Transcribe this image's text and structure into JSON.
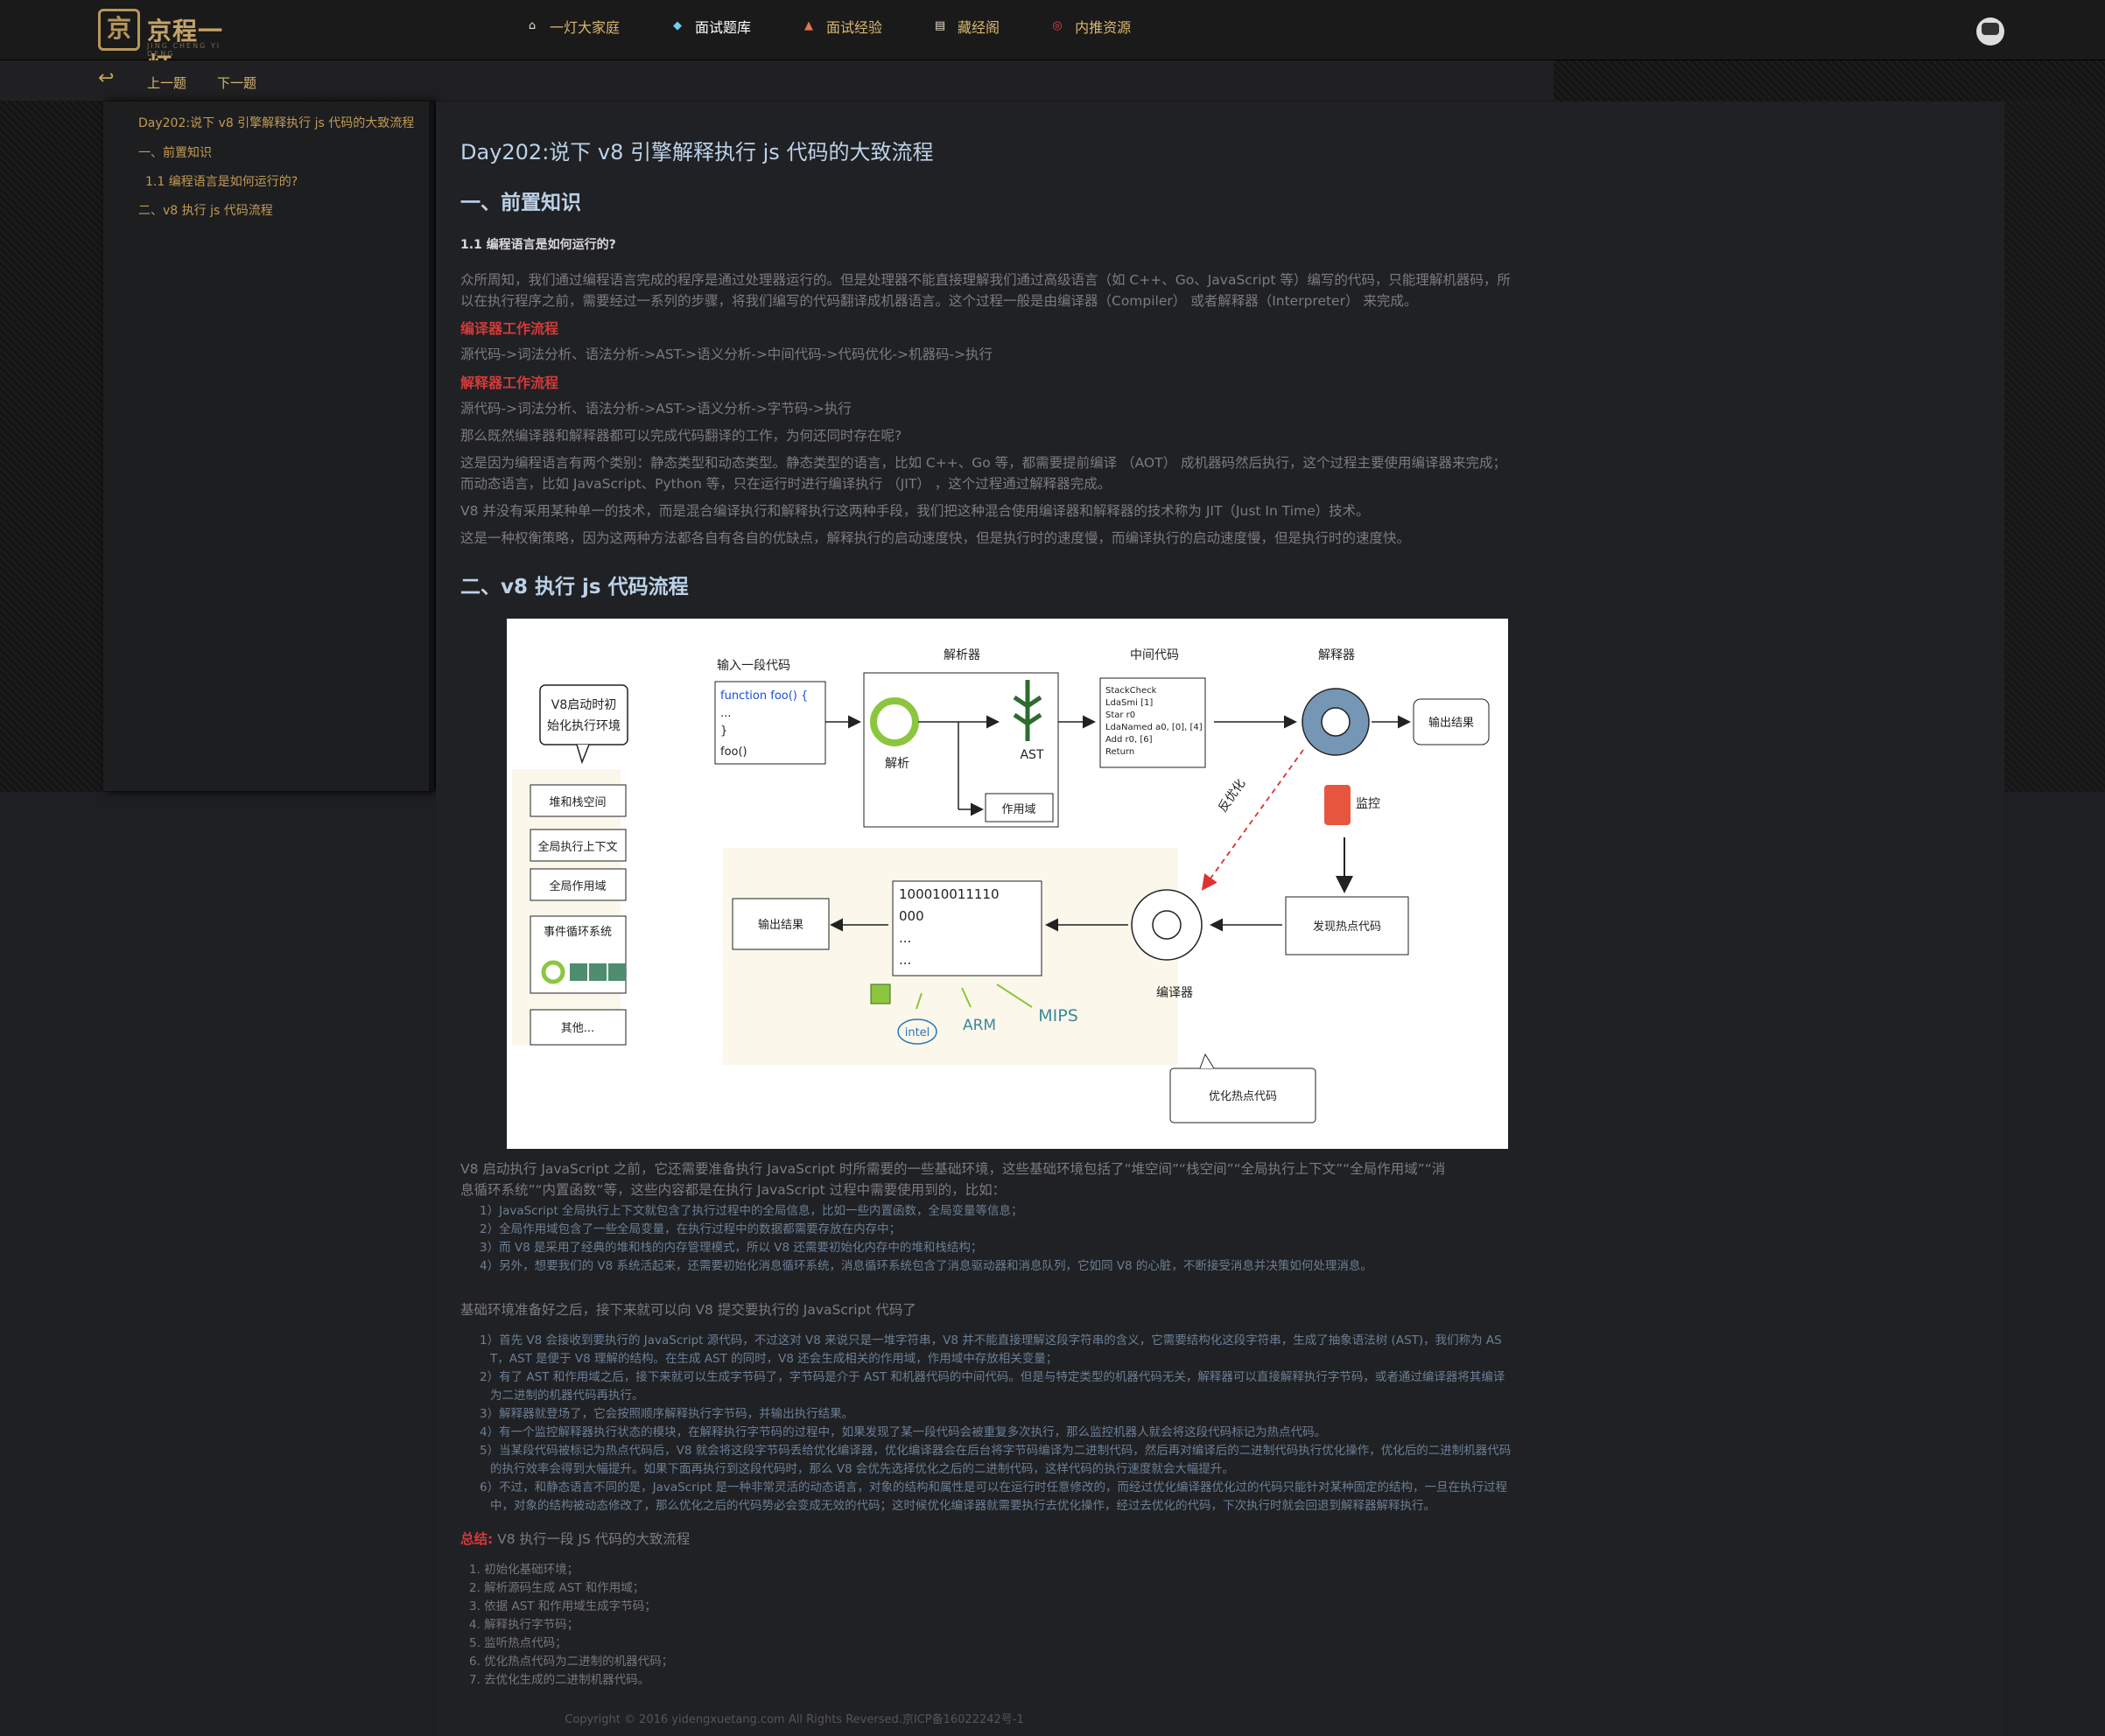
{
  "header": {
    "logo_mark": "京",
    "logo_text": "京程一灯",
    "logo_sub": "JING CHENG YI DENG",
    "nav": [
      {
        "label": "一灯大家庭",
        "icon": "home-icon"
      },
      {
        "label": "面试题库",
        "icon": "diamond-icon"
      },
      {
        "label": "面试经验",
        "icon": "shoe-icon"
      },
      {
        "label": "藏经阁",
        "icon": "book-icon"
      },
      {
        "label": "内推资源",
        "icon": "target-icon"
      }
    ],
    "active_nav": 1
  },
  "subbar": {
    "prev": "上一题",
    "next": "下一题"
  },
  "toc": [
    "Day202:说下 v8 引擎解释执行 js 代码的大致流程",
    "一、前置知识",
    "1.1 编程语言是如何运行的?",
    "二、v8 执行 js 代码流程"
  ],
  "article": {
    "title": "Day202:说下 v8 引擎解释执行 js 代码的大致流程",
    "section1": "一、前置知识",
    "sub1": "1.1 编程语言是如何运行的?",
    "p1a": "众所周知，我们通过编程语言完成的程序是通过处理器运行的。但是处理器不能直接理解我们通过高级语言（如 C++、Go、JavaScript 等）编写的代码，只能理解机器码，所",
    "p1b": "以在执行程序之前，需要经过一系列的步骤，将我们编写的代码翻译成机器语言。这个过程一般是由编译器（Compiler） 或者解释器（Interpreter） 来完成。",
    "compiler_flow_title": "编译器工作流程",
    "compiler_flow": "源代码->词法分析、语法分析->AST->语义分析->中间代码->代码优化->机器码->执行",
    "interpreter_flow_title": "解释器工作流程",
    "interpreter_flow": "源代码->词法分析、语法分析->AST->语义分析->字节码->执行",
    "p2": "那么既然编译器和解释器都可以完成代码翻译的工作，为何还同时存在呢?",
    "p3a": "这是因为编程语言有两个类别：静态类型和动态类型。静态类型的语言，比如 C++、Go 等，都需要提前编译 （AOT） 成机器码然后执行，这个过程主要使用编译器来完成；",
    "p3b": "而动态语言，比如 JavaScript、Python 等，只在运行时进行编译执行 （JIT） ，这个过程通过解释器完成。",
    "p4": "V8 并没有采用某种单一的技术，而是混合编译执行和解释执行这两种手段，我们把这种混合使用编译器和解释器的技术称为 JIT（Just In Time）技术。",
    "p5": "这是一种权衡策略，因为这两种方法都各自有各自的优缺点，解释执行的启动速度快，但是执行时的速度慢，而编译执行的启动速度慢，但是执行时的速度快。",
    "section2": "二、v8 执行 js 代码流程",
    "p6a": "V8 启动执行 JavaScript 之前，它还需要准备执行 JavaScript 时所需要的一些基础环境，这些基础环境包括了“堆空间”“栈空间”“全局执行上下文”“全局作用域”“消",
    "p6b": "息循环系统”“内置函数”等，这些内容都是在执行 JavaScript 过程中需要使用到的，比如：",
    "list1": [
      "1）JavaScript 全局执行上下文就包含了执行过程中的全局信息，比如一些内置函数，全局变量等信息；",
      "2）全局作用域包含了一些全局变量，在执行过程中的数据都需要存放在内存中；",
      "3）而 V8 是采用了经典的堆和栈的内存管理模式，所以 V8 还需要初始化内存中的堆和栈结构；",
      "4）另外，想要我们的 V8 系统活起来，还需要初始化消息循环系统，消息循环系统包含了消息驱动器和消息队列，它如同 V8 的心脏，不断接受消息并决策如何处理消息。"
    ],
    "p7": "基础环境准备好之后，接下来就可以向 V8 提交要执行的 JavaScript 代码了",
    "list2": [
      "1）首先 V8 会接收到要执行的 JavaScript 源代码，不过这对 V8 来说只是一堆字符串，V8 并不能直接理解这段字符串的含义，它需要结构化这段字符串，生成了抽象语法树 (AST)，我们称为 AS",
      "T，AST 是便于 V8 理解的结构。在生成 AST 的同时，V8 还会生成相关的作用域，作用域中存放相关变量；",
      "2）有了 AST 和作用域之后，接下来就可以生成字节码了，字节码是介于 AST 和机器代码的中间代码。但是与特定类型的机器代码无关，解释器可以直接解释执行字节码，或者通过编译器将其编译",
      "为二进制的机器代码再执行。",
      "3）解释器就登场了，它会按照顺序解释执行字节码，并输出执行结果。",
      "4）有一个监控解释器执行状态的模块，在解释执行字节码的过程中，如果发现了某一段代码会被重复多次执行，那么监控机器人就会将这段代码标记为热点代码。",
      "5）当某段代码被标记为热点代码后，V8 就会将这段字节码丢给优化编译器，优化编译器会在后台将字节码编译为二进制代码，然后再对编译后的二进制代码执行优化操作，优化后的二进制机器代码",
      "的执行效率会得到大幅提升。如果下面再执行到这段代码时，那么 V8 会优先选择优化之后的二进制代码，这样代码的执行速度就会大幅提升。",
      "6）不过，和静态语言不同的是，JavaScript 是一种非常灵活的动态语言，对象的结构和属性是可以在运行时任意修改的，而经过优化编译器优化过的代码只能针对某种固定的结构，一旦在执行过程",
      "中，对象的结构被动态修改了，那么优化之后的代码势必会变成无效的代码；这时候优化编译器就需要执行去优化操作，经过去优化的代码，下次执行时就会回退到解释器解释执行。"
    ],
    "summary_label": "总结:",
    "summary_text": " V8 执行一段 JS 代码的大致流程",
    "steps": [
      "1.  初始化基础环境；",
      "2.  解析源码生成 AST 和作用域；",
      "3.  依据 AST 和作用域生成字节码；",
      "4.  解释执行字节码；",
      "5.  监听热点代码；",
      "6.  优化热点代码为二进制的机器代码；",
      "7.  去优化生成的二进制机器代码。"
    ]
  },
  "figure": {
    "init_env": "V8启动时初始化执行环境",
    "init_env_l1": "V8启动时初",
    "init_env_l2": "始化执行环境",
    "env_items": [
      "堆和栈空间",
      "全局执行上下文",
      "全局作用域",
      "事件循环系统",
      "其他..."
    ],
    "input_code": "输入一段代码",
    "code_lines": [
      "function foo() {",
      "...",
      "}",
      "foo()"
    ],
    "parser": "解析器",
    "parse": "解析",
    "ast": "AST",
    "scope": "作用域",
    "bytecode_title": "中间代码",
    "bytecode": [
      "StackCheck",
      "LdaSmi [1]",
      "Star r0",
      "LdaNamed a0, [0], [4]",
      "Add r0, [6]",
      "Return"
    ],
    "interpreter": "解释器",
    "output": "输出结果",
    "deopt": "反优化",
    "monitor": "监控",
    "hot_code": "发现热点代码",
    "compiler": "编译器",
    "binary": [
      "100010011110",
      "000",
      "...",
      "..."
    ],
    "output2": "输出结果",
    "archs": [
      "intel",
      "ARM",
      "MIPS"
    ],
    "optimize": "优化热点代码"
  },
  "footer": "Copyright © 2016 yidengxuetang.com All Rights Reversed.京ICP备16022242号-1"
}
